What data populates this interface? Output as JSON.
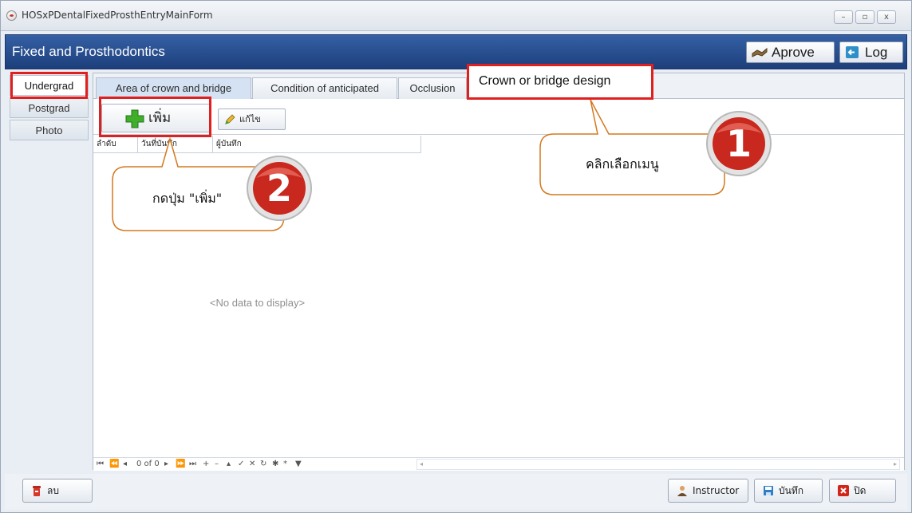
{
  "window": {
    "title": "HOSxPDentalFixedProsthEntryMainForm",
    "controls": [
      "–",
      "▫",
      "x"
    ]
  },
  "header": {
    "title": "Fixed and Prosthodontics",
    "approve_label": "Aprove",
    "log_label": "Log"
  },
  "left_nav": [
    "Undergrad",
    "Postgrad",
    "Photo"
  ],
  "tabs": [
    "Area of crown and bridge",
    "Condition of anticipated",
    "Occlusion",
    "Crown or bridge design"
  ],
  "toolbar": {
    "add_label": "เพิ่ม",
    "edit_label": "แก้ไข"
  },
  "grid": {
    "columns": [
      "ลำดับ",
      "วันที่บันทึก",
      "ผู้บันทึก"
    ],
    "empty_text": "<No data to display>",
    "record_info": "0 of 0"
  },
  "bottom": {
    "delete_label": "ลบ",
    "instructor_label": "Instructor",
    "save_label": "บันทึก",
    "close_label": "ปิด"
  },
  "tutorial": {
    "step1_number": "1",
    "step1_text": "คลิกเลือกเมนู",
    "step2_number": "2",
    "step2_text": "กดปุ่ม \"เพิ่ม\""
  },
  "colors": {
    "header_blue": "#2a4f92",
    "highlight_red": "#e02020",
    "badge_red": "#c8281e",
    "callout_border": "#d4781e"
  }
}
